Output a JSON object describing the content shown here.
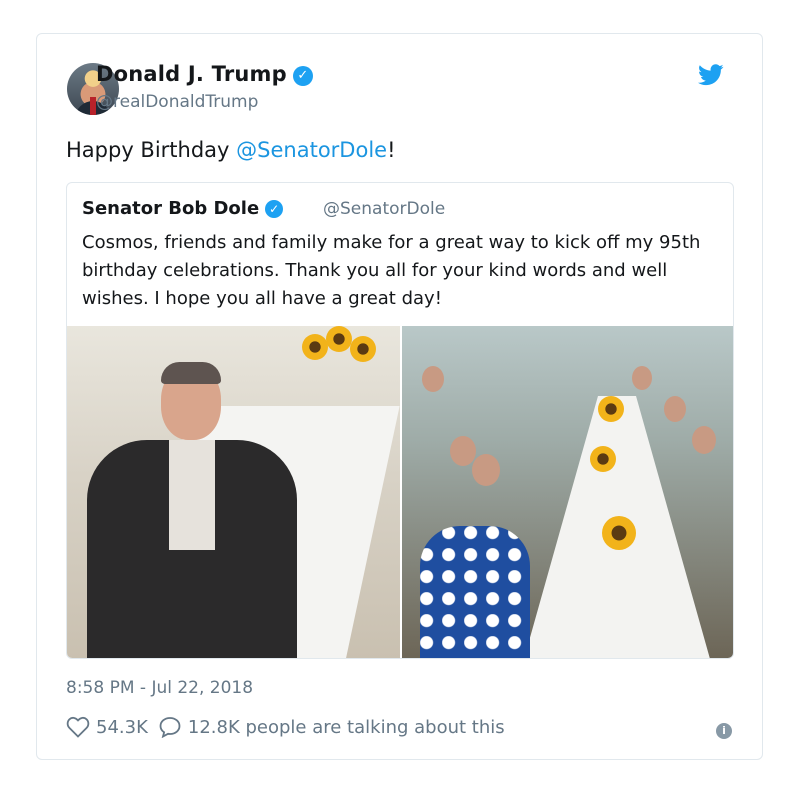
{
  "tweet": {
    "author_name": "Donald J. Trump",
    "author_handle": "@realDonaldTrump",
    "text_prefix": "Happy Birthday ",
    "mention": "@SenatorDole",
    "text_suffix": "!",
    "timestamp": "8:58 PM - Jul 22, 2018",
    "likes": "54.3K",
    "talking": "12.8K people are talking about this"
  },
  "quoted": {
    "author_name": "Senator Bob Dole",
    "author_handle": "@SenatorDole",
    "text": "Cosmos, friends and family make for a great way to kick off my 95th birthday celebrations. Thank you all for your kind words and well wishes. I hope you all have a great day!"
  },
  "icons": {
    "verified": "checkmark-badge-icon",
    "twitter": "twitter-bird-icon",
    "like": "heart-icon",
    "reply": "speech-bubble-icon",
    "info": "info-icon"
  },
  "colors": {
    "link": "#1b95e0",
    "verified": "#1da1f2",
    "muted": "#657786",
    "border": "#e1e8ed"
  }
}
